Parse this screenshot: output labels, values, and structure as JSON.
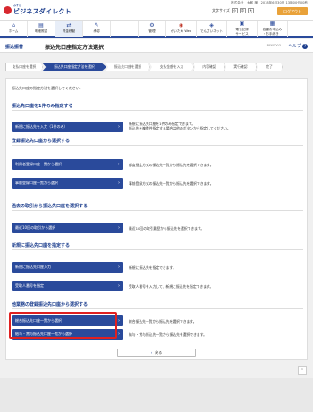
{
  "header": {
    "logo": "ビジネスダイレクト",
    "logo_sub": "みずほ",
    "user_line": "株式会社　太郎 様　2018年6月30日 13時00分00秒",
    "fontsize_label": "文字サイズ",
    "fontsize_small": "小",
    "fontsize_medium": "中",
    "fontsize_large": "大",
    "logout": "ログアウト"
  },
  "nav": [
    {
      "label": "ホーム",
      "icon": "home-icon"
    },
    {
      "label": "明細照会",
      "icon": "document-icon"
    },
    {
      "label": "資金移動",
      "icon": "transfer-icon"
    },
    {
      "label": "承認",
      "icon": "approve-icon"
    },
    {
      "label": "",
      "icon": "blank-icon"
    },
    {
      "label": "管理",
      "icon": "manage-icon"
    },
    {
      "label": "がいため Web",
      "icon": "globe-icon"
    },
    {
      "label": "でんさいネット",
      "icon": "network-icon"
    },
    {
      "label": "電子記録\nサービス",
      "icon": "record-icon"
    },
    {
      "label": "各種お申込み\n・お手続き",
      "icon": "form-icon"
    }
  ],
  "titlebar": {
    "category": "振込振替",
    "title": "振込先口座指定方法選択",
    "code": "BFKF003",
    "help": "ヘルプ"
  },
  "steps": [
    "支払口座を選択",
    "振込先口座指定方法を選択",
    "振込先口座を選択",
    "支払金額を入力",
    "内容確認",
    "実行確認",
    "完了"
  ],
  "intro": "振込先口座の指定方法を選択してください。",
  "sections": [
    {
      "title": "振込先口座を1件のみ指定する"
    },
    {
      "title": "登録振込先口座から選択する"
    },
    {
      "title": "過去の取引から振込先口座を選択する"
    },
    {
      "title": "新規に振込先口座を指定する"
    },
    {
      "title": "他業務の登録振込先口座から選択する"
    }
  ],
  "buttons": [
    {
      "label": "新規に振込先を入力（1件のみ）",
      "desc": "新規に振込先口座を1件のみ指定できます。\n振込先を複数件指定する場合は他のボタンから指定してください。"
    },
    {
      "label": "利用者登録口座一覧から選択",
      "desc": "都度指定方式の振込先一覧から振込先を選択できます。"
    },
    {
      "label": "事前登録口座一覧から選択",
      "desc": "事前登録方式の振込先一覧から振込先を選択できます。"
    },
    {
      "label": "最近10回の取引から選択",
      "desc": "最近10回の取引履歴から振込先を選択できます。"
    },
    {
      "label": "新規に振込先口座入力",
      "desc": "新規に振込先を指定できます。"
    },
    {
      "label": "受取人番号を指定",
      "desc": "受取人番号を入力して、新規に振込先を指定できます。"
    },
    {
      "label": "総合振込先口座一覧から選択",
      "desc": "総合振込先一覧から振込先を選択できます。"
    },
    {
      "label": "給与・賞与振込先口座一覧から選択",
      "desc": "給与・賞与振込先一覧から振込先を選択できます。"
    }
  ],
  "back": "戻る"
}
